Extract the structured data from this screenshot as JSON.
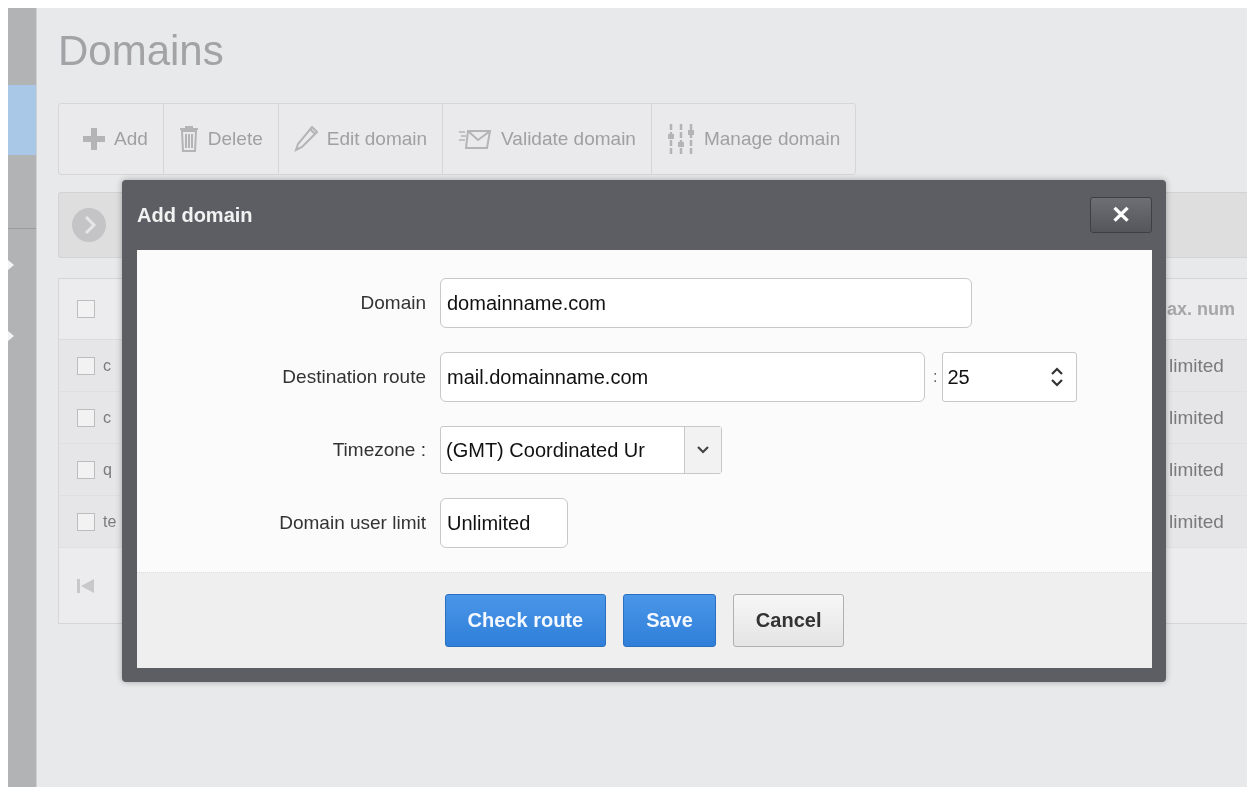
{
  "page": {
    "title": "Domains"
  },
  "toolbar": [
    {
      "label": "Add",
      "kind": "add"
    },
    {
      "label": "Delete",
      "kind": "delete"
    },
    {
      "label": "Edit domain",
      "kind": "edit"
    },
    {
      "label": "Validate domain",
      "kind": "validate"
    },
    {
      "label": "Manage domain",
      "kind": "manage"
    }
  ],
  "table": {
    "header": {
      "checked": false,
      "column_last": "ax. num"
    },
    "rows": [
      {
        "checked": false,
        "column_1": "c",
        "column_last": "limited"
      },
      {
        "checked": false,
        "column_1": "c",
        "column_last": "limited"
      },
      {
        "checked": false,
        "column_1": "q",
        "column_last": "limited"
      },
      {
        "checked": false,
        "column_1": "te",
        "column_last": "limited"
      }
    ]
  },
  "dialog": {
    "title": "Add domain",
    "close": "✕",
    "fields": [
      {
        "kind": "text",
        "label": "Domain",
        "value": "domainname.com"
      },
      {
        "kind": "route",
        "label": "Destination route",
        "value": "mail.domainname.com",
        "separator": ":",
        "port": "25"
      },
      {
        "kind": "select",
        "label": "Timezone :",
        "value": "(GMT) Coordinated Ur"
      },
      {
        "kind": "short",
        "label": "Domain user limit",
        "value": "Unlimited"
      }
    ],
    "buttons": [
      {
        "label": "Check route",
        "kind": "primary"
      },
      {
        "label": "Save",
        "kind": "primary"
      },
      {
        "label": "Cancel",
        "kind": "secondary"
      }
    ]
  }
}
